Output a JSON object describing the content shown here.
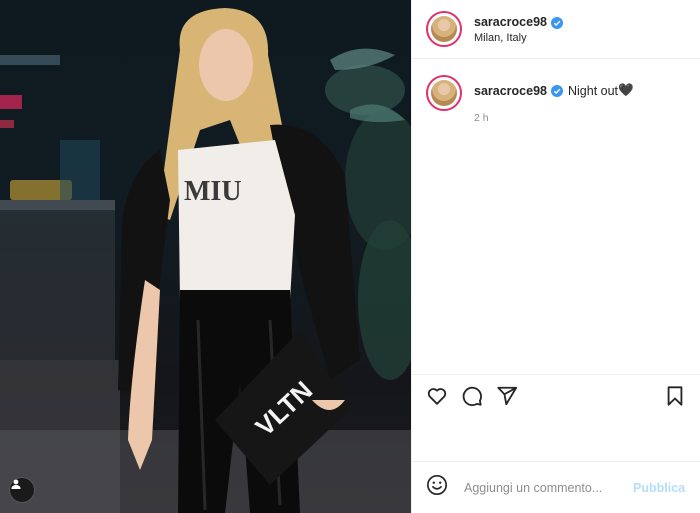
{
  "post": {
    "username": "saracroce98",
    "location": "Milan, Italy",
    "caption": "Night out",
    "caption_emoji": "🖤",
    "time_ago": "2 h",
    "shirt_text": "MIU",
    "clutch_text": "VLTN"
  },
  "comment_box": {
    "placeholder": "Aggiungi un commento...",
    "publish_label": "Pubblica"
  },
  "colors": {
    "verified": "#3897f0",
    "story_ring": "#e1306c",
    "publish_disabled": "#b2dffc"
  },
  "icons": [
    "heart-icon",
    "comment-icon",
    "share-icon",
    "bookmark-icon",
    "emoji-icon",
    "user-tag-icon",
    "verified-badge-icon"
  ]
}
